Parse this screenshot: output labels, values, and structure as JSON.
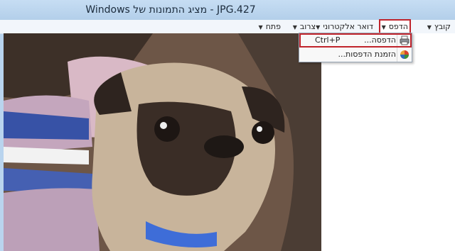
{
  "window": {
    "title": "Windows מציג התמונות של - JPG.427"
  },
  "menubar": {
    "file": "קובץ",
    "print": "הדפס",
    "email": "דואר אלקטרוני",
    "burn": "צרוב",
    "open": "פתח"
  },
  "print_menu": {
    "print_label": "הדפסה...",
    "print_shortcut": "Ctrl+P",
    "order_prints_label": "הזמנת הדפסות..."
  },
  "icons": [
    "printer-icon",
    "order-prints-icon"
  ]
}
